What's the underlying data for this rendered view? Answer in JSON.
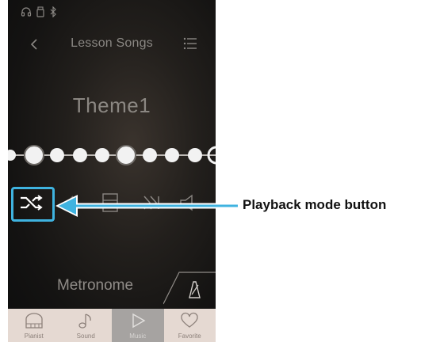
{
  "nav": {
    "title": "Lesson Songs"
  },
  "song": {
    "title": "Theme1"
  },
  "controls": {
    "icons": [
      "shuffle-icon",
      "rewind-icon",
      "score-icon",
      "forward-icon",
      "volume-icon"
    ]
  },
  "metronome": {
    "label": "Metronome"
  },
  "tabs": [
    {
      "label": "Pianist",
      "icon": "piano-icon",
      "active": false
    },
    {
      "label": "Sound",
      "icon": "music-note-icon",
      "active": false
    },
    {
      "label": "Music",
      "icon": "play-icon",
      "active": true
    },
    {
      "label": "Favorite",
      "icon": "heart-icon",
      "active": false
    }
  ],
  "annotation": {
    "label": "Playback mode button",
    "color": "#3fb3e0"
  }
}
